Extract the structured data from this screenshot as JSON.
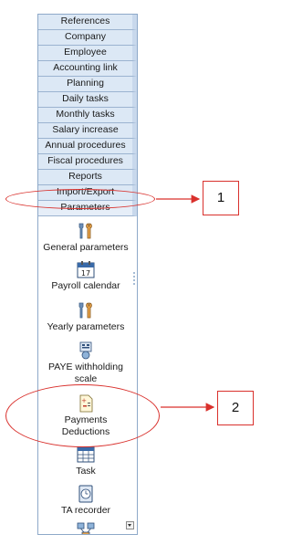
{
  "menu": [
    {
      "label": "References"
    },
    {
      "label": "Company"
    },
    {
      "label": "Employee"
    },
    {
      "label": "Accounting link"
    },
    {
      "label": "Planning"
    },
    {
      "label": "Daily tasks"
    },
    {
      "label": "Monthly tasks"
    },
    {
      "label": "Salary increase"
    },
    {
      "label": "Annual procedures"
    },
    {
      "label": "Fiscal procedures"
    },
    {
      "label": "Reports"
    },
    {
      "label": "Import/Export"
    },
    {
      "label": "Parameters"
    }
  ],
  "tools": [
    {
      "label": "General parameters",
      "icon": "wrench-tools-icon"
    },
    {
      "label": "Payroll calendar",
      "icon": "calendar-icon"
    },
    {
      "label": "Yearly parameters",
      "icon": "wrench-tools-icon"
    },
    {
      "label": "PAYE withholding",
      "label2": "scale",
      "icon": "scale-document-icon"
    },
    {
      "label": "Payments",
      "label2": "Deductions",
      "icon": "document-plus-minus-icon"
    },
    {
      "label": "Task",
      "icon": "task-grid-icon"
    },
    {
      "label": "TA recorder",
      "icon": "time-recorder-icon"
    },
    {
      "label": "",
      "icon": "network-icon"
    }
  ],
  "callouts": {
    "one": "1",
    "two": "2"
  },
  "colors": {
    "annotation": "#d9302c",
    "menu_bg": "#dce8f5",
    "panel_border": "#8ea9c9"
  }
}
